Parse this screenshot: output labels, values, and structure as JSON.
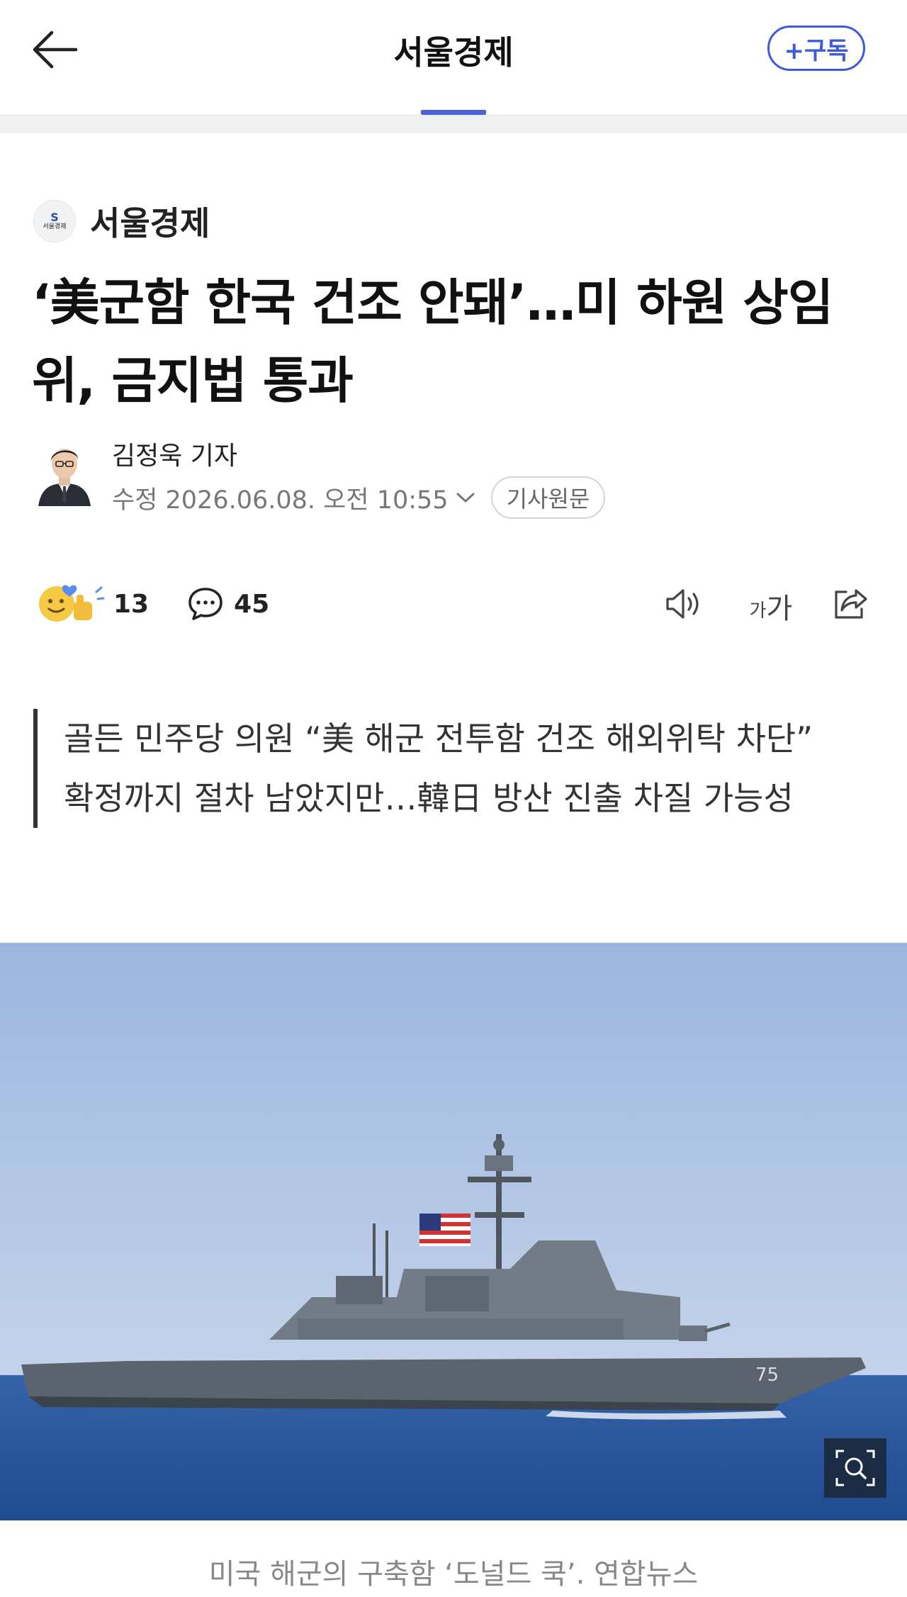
{
  "header": {
    "title": "서울경제",
    "subscribe_label": "+구독"
  },
  "press": {
    "logo_text": "서울경제",
    "name": "서울경제"
  },
  "article": {
    "headline": "‘美군함 한국 건조 안돼’…미 하원 상임위, 금지법 통과",
    "author": "김정욱 기자",
    "timestamp": "수정 2026.06.08. 오전 10:55",
    "original_label": "기사원문",
    "reaction_count": "13",
    "comment_count": "45",
    "font_small": "가",
    "font_big": "가",
    "summary": [
      "골든 민주당 의원 “美 해군 전투함 건조 해외위탁 차단”",
      "확정까지 절차 남았지만…韓日 방산 진출 차질 가능성"
    ],
    "hull_number": "75",
    "photo_caption": "미국 해군의 구축함 ‘도널드 쿡’. 연합뉴스"
  },
  "icons": {
    "back": "arrow-left-icon",
    "reaction": "emoji-reaction-icon",
    "comment": "speech-bubble-icon",
    "listen": "speaker-icon",
    "font_size": "font-size-icon",
    "share": "share-icon",
    "zoom": "zoom-search-icon",
    "chevron": "chevron-down-icon"
  },
  "colors": {
    "accent": "#3b5bdb",
    "indicator": "#4a63d8",
    "sky": "#a9bfe3",
    "sea": "#27549a",
    "ship": "#5f6874"
  }
}
